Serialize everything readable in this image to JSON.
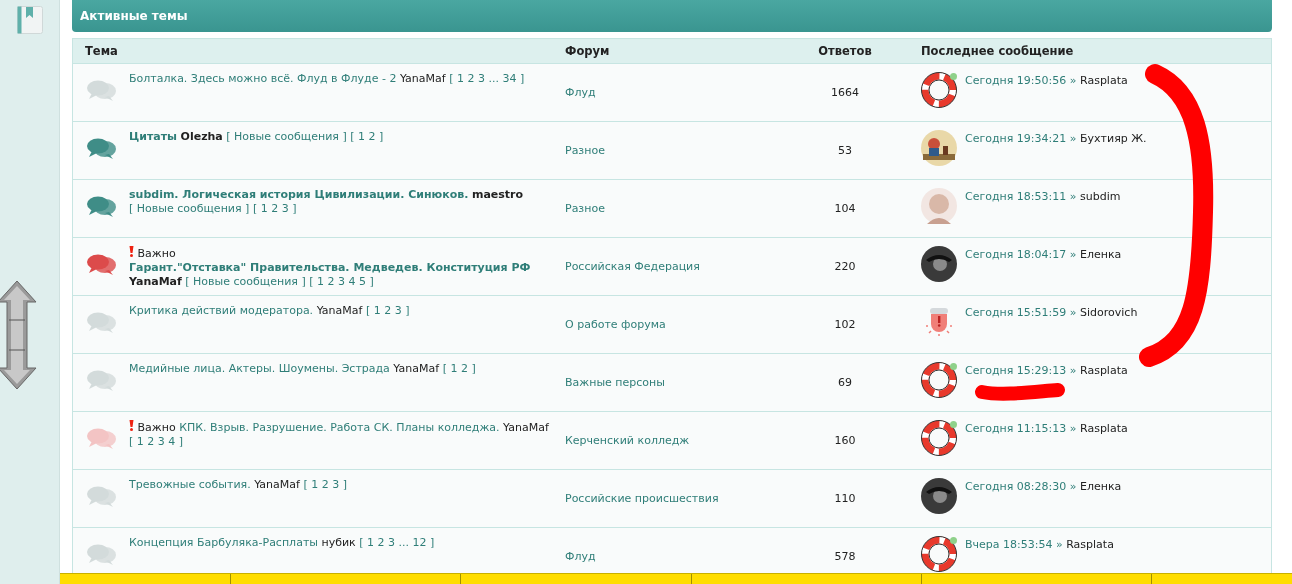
{
  "section": {
    "title": "Активные темы"
  },
  "table": {
    "columns": [
      "Тема",
      "Форум",
      "Ответов",
      "Последнее сообщение"
    ],
    "rows": [
      {
        "unread": false,
        "important": false,
        "topic": {
          "title": "Болталка. Здесь можно всё. Флуд в Флуде - 2",
          "author": "YanaMaf",
          "pages": "[ 1 2 3 ... 34 ]"
        },
        "forum": "Флуд",
        "replies": "1664",
        "last_post": {
          "avatar": {
            "kind": "lifebuoy"
          },
          "online": true,
          "time": "Сегодня 19:50:56",
          "sep": "»",
          "user": "Rasplata"
        }
      },
      {
        "unread": true,
        "important": false,
        "topic": {
          "title": "Цитаты",
          "author": "Olezha",
          "new_posts": "[ Новые сообщения ]",
          "pages": "[ 1 2 ]"
        },
        "forum": "Разное",
        "replies": "53",
        "last_post": {
          "avatar": {
            "kind": "cartoon"
          },
          "online": false,
          "time": "Сегодня 19:34:21",
          "sep": "»",
          "user": "Бухтияр Ж."
        }
      },
      {
        "unread": true,
        "important": false,
        "topic": {
          "title": "subdim. Логическая история Цивилизации. Синюков.",
          "author": "maestro",
          "new_posts": "[ Новые сообщения ]",
          "pages": "[ 1 2 3 ]"
        },
        "forum": "Разное",
        "replies": "104",
        "last_post": {
          "avatar": {
            "kind": "person"
          },
          "online": false,
          "time": "Сегодня 18:53:11",
          "sep": "»",
          "user": "subdim"
        }
      },
      {
        "unread": true,
        "important": true,
        "topic": {
          "prefix": "Важно",
          "title": "Гарант.\"Отставка\" Правительства. Медведев. Конституция РФ",
          "author": "YanaMaf",
          "new_posts": "[ Новые сообщения ]",
          "pages": "[ 1 2 3 4 5 ]"
        },
        "forum": "Российская Федерация",
        "replies": "220",
        "last_post": {
          "avatar": {
            "kind": "dark"
          },
          "online": false,
          "time": "Сегодня 18:04:17",
          "sep": "»",
          "user": "Еленка"
        }
      },
      {
        "unread": false,
        "important": false,
        "topic": {
          "title": "Критика действий модератора.",
          "author": "YanaMaf",
          "pages": "[ 1 2 3 ]"
        },
        "forum": "О работе форума",
        "replies": "102",
        "last_post": {
          "avatar": {
            "kind": "siren"
          },
          "online": false,
          "time": "Сегодня 15:51:59",
          "sep": "»",
          "user": "Sidorovich"
        }
      },
      {
        "unread": false,
        "important": false,
        "topic": {
          "title": "Медийные лица. Актеры. Шоумены. Эстрада",
          "author": "YanaMaf",
          "pages": "[ 1 2 ]"
        },
        "forum": "Важные персоны",
        "replies": "69",
        "last_post": {
          "avatar": {
            "kind": "lifebuoy"
          },
          "online": true,
          "time": "Сегодня 15:29:13",
          "sep": "»",
          "user": "Rasplata"
        }
      },
      {
        "unread": false,
        "important": true,
        "topic": {
          "prefix": "Важно",
          "title": "КПК. Взрыв. Разрушение. Работа СК. Планы колледжа.",
          "author": "YanaMaf",
          "pages": "[ 1 2 3 4 ]"
        },
        "forum": "Керченский колледж",
        "replies": "160",
        "last_post": {
          "avatar": {
            "kind": "lifebuoy"
          },
          "online": true,
          "time": "Сегодня 11:15:13",
          "sep": "»",
          "user": "Rasplata"
        }
      },
      {
        "unread": false,
        "important": false,
        "topic": {
          "title": "Тревожные события.",
          "author": "YanaMaf",
          "pages": "[ 1 2 3 ]"
        },
        "forum": "Российские происшествия",
        "replies": "110",
        "last_post": {
          "avatar": {
            "kind": "dark"
          },
          "online": false,
          "time": "Сегодня 08:28:30",
          "sep": "»",
          "user": "Еленка"
        }
      },
      {
        "unread": false,
        "important": false,
        "topic": {
          "title": "Концепция Барбуляка-Расплаты",
          "author": "нубик",
          "pages": "[ 1 2 3 ... 12 ]"
        },
        "forum": "Флуд",
        "replies": "578",
        "last_post": {
          "avatar": {
            "kind": "lifebuoy"
          },
          "online": true,
          "time": "Вчера 18:53:54",
          "sep": "»",
          "user": "Rasplata"
        }
      }
    ]
  }
}
